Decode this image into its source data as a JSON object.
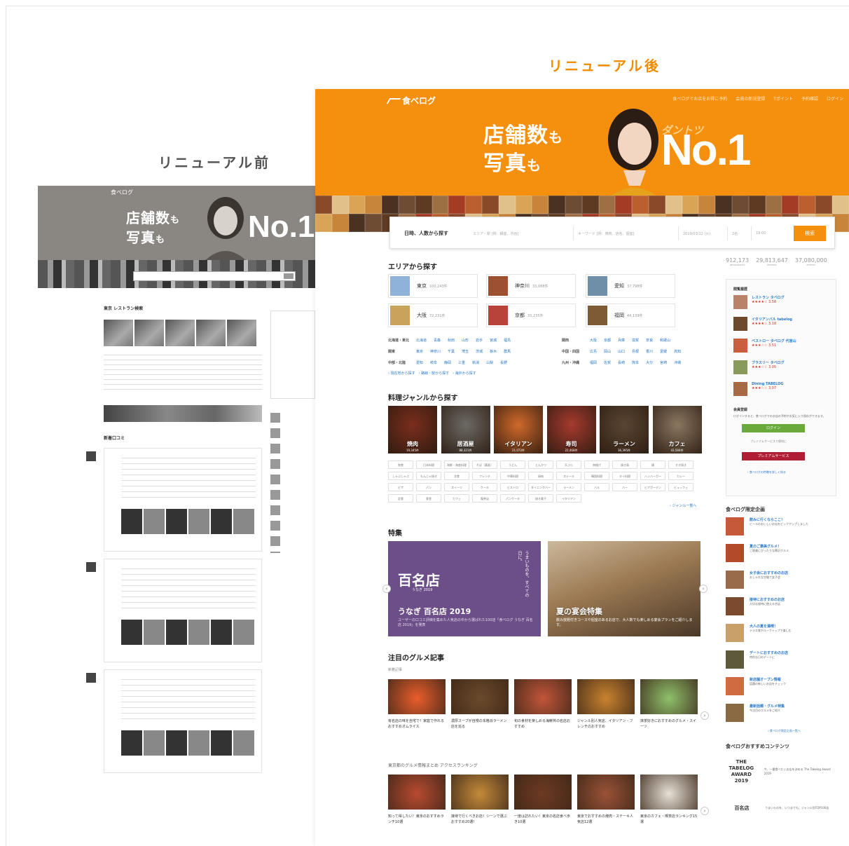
{
  "captions": {
    "before": "リニューアル前",
    "after": "リニューアル後"
  },
  "before": {
    "logo": "食べログ",
    "hero_line1": "店舗数",
    "hero_line1_small": "も",
    "hero_line2": "写真",
    "hero_line2_small": "も",
    "hero_no1": "No.1",
    "section_title": "東京 レストラン検索",
    "feed_title": "新着口コミ"
  },
  "after": {
    "logo": "食べログ",
    "topnav": [
      "食べログでお店をお得に予約",
      "会員の新規登録",
      "Tポイント",
      "予約確認",
      "ログイン"
    ],
    "hero": {
      "line1": "店舗数",
      "line1_small": "も",
      "line2": "写真",
      "line2_small": "も",
      "dantotsu": "ダントツ",
      "no1": "No.1"
    },
    "search": {
      "label": "日時、人数から探す",
      "area_placeholder": "エリア・駅 [例：銀座、渋谷]",
      "keyword_placeholder": "キーワード [例：焼肉、店名、個室]",
      "date": "2019/03/12 (火)",
      "people": "2名",
      "time": "19:00",
      "button": "検索"
    },
    "area_title": "エリアから探す",
    "areas": [
      {
        "name": "東京",
        "count": "100,243件",
        "color": "#8fb3d8"
      },
      {
        "name": "神奈川",
        "count": "33,088件",
        "color": "#9c5232"
      },
      {
        "name": "愛知",
        "count": "37,798件",
        "color": "#6f8fa8"
      },
      {
        "name": "大阪",
        "count": "72,231件",
        "color": "#c9a25b"
      },
      {
        "name": "京都",
        "count": "33,235件",
        "color": "#b8433a"
      },
      {
        "name": "福岡",
        "count": "44,139件",
        "color": "#7e5a35"
      }
    ],
    "area_rows": [
      {
        "region": "北海道・東北",
        "prefs": [
          "北海道",
          "青森",
          "秋田",
          "山形",
          "岩手",
          "宮城",
          "福島"
        ]
      },
      {
        "region": "関東",
        "prefs": [
          "東京",
          "神奈川",
          "千葉",
          "埼玉",
          "茨城",
          "栃木",
          "群馬"
        ]
      },
      {
        "region": "中部・北陸",
        "prefs": [
          "愛知",
          "岐阜",
          "静岡",
          "三重",
          "新潟",
          "山梨",
          "長野"
        ]
      }
    ],
    "area_rows_right": [
      {
        "region": "関西",
        "prefs": [
          "大阪",
          "京都",
          "兵庫",
          "滋賀",
          "奈良",
          "和歌山"
        ]
      },
      {
        "region": "中国・四国",
        "prefs": [
          "広島",
          "岡山",
          "山口",
          "島根",
          "香川",
          "愛媛",
          "高知"
        ]
      },
      {
        "region": "九州・沖縄",
        "prefs": [
          "福岡",
          "佐賀",
          "長崎",
          "熊本",
          "大分",
          "宮崎",
          "沖縄"
        ]
      }
    ],
    "area_more": "› 現在地から探す　› 路線・駅から探す　› 海外から探す",
    "genre_title": "料理ジャンルから探す",
    "genres": [
      {
        "name": "焼肉",
        "count": "19,345件",
        "color": "#7b2e1c"
      },
      {
        "name": "居酒屋",
        "count": "88,321件",
        "color": "#6c6a64"
      },
      {
        "name": "イタリアン",
        "count": "21,072件",
        "color": "#d1692a"
      },
      {
        "name": "寿司",
        "count": "22,468件",
        "color": "#a63a2e"
      },
      {
        "name": "ラーメン",
        "count": "36,395件",
        "color": "#5a4632"
      },
      {
        "name": "カフェ",
        "count": "43,584件",
        "color": "#8a7760"
      }
    ],
    "tags": [
      "和食",
      "日本料理",
      "海鮮・海産料理",
      "そば（蕎麦）",
      "うどん",
      "とんかつ",
      "天ぷら",
      "串揚げ",
      "焼き鳥",
      "鍋",
      "すき焼き",
      "しゃぶしゃぶ",
      "もんじゃ焼き",
      "洋食",
      "フレンチ",
      "中華料理",
      "焼肉",
      "ステーキ",
      "韓国料理",
      "タイ料理",
      "ハンバーガー",
      "カレー",
      "ピザ",
      "パン",
      "スイーツ",
      "ケーキ",
      "ビストロ",
      "ダイニングバー",
      "ラーメン",
      "バル",
      "バー",
      "ビアガーデン",
      "ビュッフェ",
      "定食",
      "食堂",
      "カフェ",
      "喫茶店",
      "パンケーキ",
      "焼き菓子",
      "イタリアン"
    ],
    "genre_more": "› ジャンル一覧へ",
    "feature_title": "特集",
    "features": [
      {
        "brand": "百名店",
        "year": "うなぎ 2019",
        "vertical": "うまいものを、すべての日に。",
        "title": "うなぎ 百名店 2019",
        "desc": "ユーザーの口コミ評価を集めた人気店の中から選ばれた100店「食べログ うなぎ 百名店 2019」を発表"
      },
      {
        "title": "夏の宴会特集",
        "desc": "飲み放題付きコースや個室のあるお店で、大人数でも楽しめる宴会プランをご紹介します。"
      }
    ],
    "articles_title": "注目のグルメ記事",
    "articles_sub": "新着記事",
    "articles": [
      {
        "text": "有名店の味を自宅で！家庭で作れるおすすめオムライス",
        "color": "#e95d2b"
      },
      {
        "text": "濃厚スープが自慢の本格派ラーメン店を巡る",
        "color": "#6b4a2a"
      },
      {
        "text": "旬の食材を楽しめる海鮮丼の名店おすすめ",
        "color": "#c2553a"
      },
      {
        "text": "ジャンル別人気店、イタリアン・フレンチのおすすめ",
        "color": "#c9822e"
      },
      {
        "text": "抹茶好きにおすすめのグルメ・スイーツ",
        "color": "#8fc06b"
      }
    ],
    "ranking_title": "東京都のグルメ情報まとめ アクセスランキング",
    "ranking": [
      {
        "text": "知って得したい！東京のおすすめランチ10選",
        "color": "#b84a30"
      },
      {
        "text": "接待で行くべきお店！シーンで選ぶおすすめ20選！",
        "color": "#c48a3a"
      },
      {
        "text": "一度は訪れたい！東京の名店食べ歩き10選",
        "color": "#6e3a22"
      },
      {
        "text": "東京でおすすめの焼肉・ステーキ人気店12選",
        "color": "#9a5236"
      },
      {
        "text": "東京のカフェ・喫茶店ランキング15選",
        "color": "#e6e0d6"
      }
    ],
    "stats": [
      {
        "value": "912,173",
        "label": "RESTAURANTS"
      },
      {
        "value": "29,813,647",
        "label": "REVIEWS"
      },
      {
        "value": "37,080,000",
        "label": "PHOTOS"
      }
    ],
    "history_title": "閲覧履歴",
    "history": [
      {
        "name": "レストラン タベログ",
        "stars": "★★★★☆ 3.58",
        "color": "#b9826a"
      },
      {
        "name": "イタリアンバル tabelog",
        "stars": "★★★★☆ 3.18",
        "color": "#6d4a2e"
      },
      {
        "name": "ベストロー タベログ 代官山",
        "stars": "★★★☆☆ 3.51",
        "color": "#c95f3e"
      },
      {
        "name": "ブラスリー タベログ",
        "stars": "★★★☆☆ 3.05",
        "color": "#8a9a5c"
      },
      {
        "name": "Dining TABELOG",
        "stars": "★★★☆☆ 3.07",
        "color": "#a86a44"
      }
    ],
    "member_title": "会員登録",
    "member_desc": "ログインすると、食べログでのお店の予約やお気に入り保存ができます。",
    "login_button": "ログイン",
    "premium_note": "プレミアムサービスで便利に",
    "premium_button": "プレミアムサービス",
    "more_features": "› 食べログの特徴を詳しく知る",
    "campaign_title": "食べログ限定企画",
    "campaigns": [
      {
        "name": "飲みに行くならここ！",
        "desc": "ビールのおいしいお店をピックアップしました",
        "color": "#c6593a"
      },
      {
        "name": "夏のご褒美グルメ！",
        "desc": "ご褒美にぴったりな贅沢グルメ",
        "color": "#b34a2a"
      },
      {
        "name": "女子会におすすめのお店",
        "desc": "おしゃれな空間で女子会",
        "color": "#9a6b4a"
      },
      {
        "name": "接待におすすめのお店",
        "desc": "大切な接待に使える名店",
        "color": "#7c4a2c"
      },
      {
        "name": "大人の夏を満喫！",
        "desc": "テラス席やルーフトップで楽しむ",
        "color": "#caa06a"
      },
      {
        "name": "デートにおすすめのお店",
        "desc": "特別な日のデートに",
        "color": "#5c5a3a"
      },
      {
        "name": "新店舗オープン情報",
        "desc": "話題の新しいお店をチェック",
        "color": "#d06a40"
      },
      {
        "name": "最新話題・グルメ特集",
        "desc": "今注目のグルメをご紹介",
        "color": "#8a6a42"
      }
    ],
    "campaign_more": "› 食べログ限定企画一覧へ",
    "recommend_title": "食べログおすすめコンテンツ",
    "recommend": [
      {
        "logo": "THE TABELOG AWARD 2019",
        "desc": "今、一番食べたいお店を決める The Tabelog Award 2019"
      },
      {
        "logo": "百名店",
        "desc": "うまいものを、いつまでも。ジャンル別TOP100店"
      }
    ]
  }
}
